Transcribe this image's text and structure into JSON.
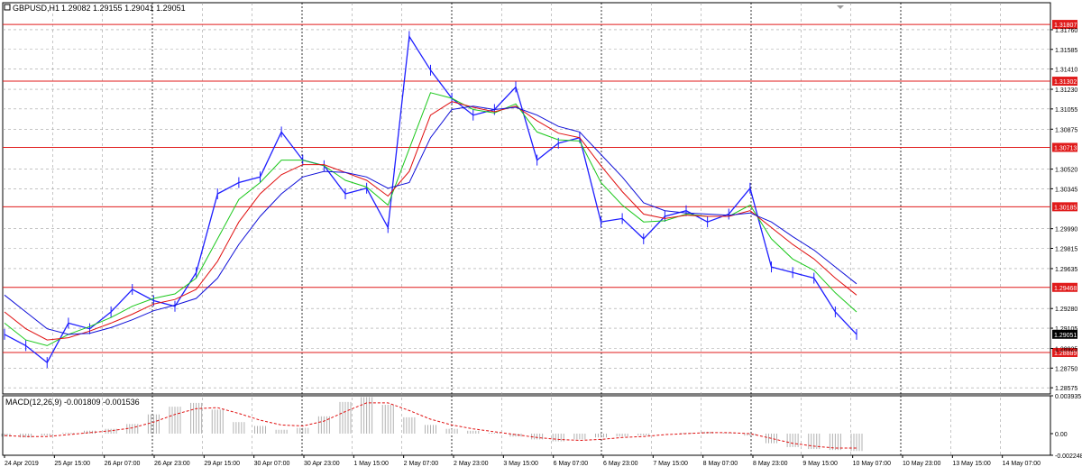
{
  "window": {
    "title": "GBPUSD,H1",
    "ohlc": "1.29082 1.29155 1.29041 1.29051"
  },
  "indicator": {
    "label": "MACD(12,26,9) -0.001809 -0.001536"
  },
  "price_axis": {
    "ticks": [
      "1.31760",
      "1.31585",
      "1.31410",
      "1.31230",
      "1.31055",
      "1.30875",
      "1.30520",
      "1.30345",
      "1.29990",
      "1.29815",
      "1.29635",
      "1.29280",
      "1.29105",
      "1.28925",
      "1.28750",
      "1.28575"
    ],
    "current_price": "1.29051"
  },
  "hlines": [
    {
      "label": "1.31807",
      "price": 1.31807
    },
    {
      "label": "1.31302",
      "price": 1.31302
    },
    {
      "label": "1.30713",
      "price": 1.30713
    },
    {
      "label": "1.30185",
      "price": 1.30185
    },
    {
      "label": "1.29468",
      "price": 1.29468
    },
    {
      "label": "1.28889",
      "price": 1.28889
    }
  ],
  "macd_axis": {
    "ticks": [
      "0.003935",
      "0.00",
      "-0.002248"
    ]
  },
  "time_axis": {
    "labels": [
      "24 Apr 2019",
      "25 Apr 15:00",
      "26 Apr 07:00",
      "26 Apr 23:00",
      "29 Apr 15:00",
      "30 Apr 07:00",
      "30 Apr 23:00",
      "1 May 15:00",
      "2 May 07:00",
      "2 May 23:00",
      "3 May 15:00",
      "6 May 07:00",
      "6 May 23:00",
      "7 May 15:00",
      "8 May 07:00",
      "8 May 23:00",
      "9 May 15:00",
      "10 May 07:00",
      "10 May 23:00",
      "13 May 15:00",
      "14 May 07:00"
    ]
  },
  "chart_data": {
    "type": "line",
    "title": "GBPUSD,H1",
    "series": [
      {
        "name": "GBPUSD,H1",
        "values": [
          1.2905,
          1.2895,
          1.288,
          1.2915,
          1.291,
          1.2925,
          1.2945,
          1.2935,
          1.293,
          1.296,
          1.303,
          1.304,
          1.3045,
          1.3085,
          1.306,
          1.3055,
          1.303,
          1.3035,
          1.3,
          1.317,
          1.314,
          1.3115,
          1.31,
          1.3105,
          1.3125,
          1.306,
          1.3075,
          1.308,
          1.3005,
          1.3008,
          1.299,
          1.301,
          1.3015,
          1.3005,
          1.3012,
          1.3035,
          1.2965,
          1.296,
          1.2955,
          1.2925,
          1.2905
        ]
      },
      {
        "name": "",
        "values": [
          1.2915,
          1.29,
          1.2895,
          1.2905,
          1.2912,
          1.292,
          1.293,
          1.2937,
          1.2941,
          1.2955,
          1.299,
          1.3025,
          1.304,
          1.306,
          1.306,
          1.3055,
          1.3042,
          1.3036,
          1.302,
          1.307,
          1.312,
          1.3115,
          1.3105,
          1.3102,
          1.311,
          1.3085,
          1.3078,
          1.3077,
          1.304,
          1.302,
          1.3005,
          1.3006,
          1.3012,
          1.301,
          1.301,
          1.302,
          1.299,
          1.2972,
          1.2962,
          1.2942,
          1.2925
        ]
      },
      {
        "name": "",
        "values": [
          1.2925,
          1.291,
          1.29,
          1.2902,
          1.2908,
          1.2915,
          1.2923,
          1.2932,
          1.2936,
          1.2945,
          1.297,
          1.3005,
          1.303,
          1.3047,
          1.3056,
          1.3056,
          1.3049,
          1.3042,
          1.3028,
          1.305,
          1.31,
          1.3112,
          1.3107,
          1.3103,
          1.3108,
          1.3095,
          1.3084,
          1.308,
          1.3055,
          1.3032,
          1.3012,
          1.3008,
          1.3011,
          1.301,
          1.301,
          1.3015,
          1.3,
          1.2985,
          1.2972,
          1.2955,
          1.294
        ]
      },
      {
        "name": "",
        "values": [
          1.294,
          1.2925,
          1.291,
          1.2905,
          1.2906,
          1.2911,
          1.2918,
          1.2926,
          1.2931,
          1.2937,
          1.2955,
          1.2985,
          1.301,
          1.303,
          1.3045,
          1.305,
          1.3049,
          1.3045,
          1.3035,
          1.304,
          1.308,
          1.3105,
          1.3108,
          1.3105,
          1.3107,
          1.31,
          1.309,
          1.3085,
          1.3065,
          1.3045,
          1.3022,
          1.3015,
          1.3013,
          1.3012,
          1.3011,
          1.3013,
          1.3005,
          1.2992,
          1.298,
          1.2965,
          1.295
        ]
      }
    ],
    "macd_values": [
      -0.0003,
      -0.0004,
      -0.0002,
      0.0001,
      0.0003,
      0.0005,
      0.001,
      0.002,
      0.0028,
      0.0032,
      0.0025,
      0.0012,
      0.0008,
      0.0004,
      0.0006,
      0.0018,
      0.0033,
      0.0038,
      0.003,
      0.0017,
      0.0009,
      0.0005,
      0.0003,
      0.0001,
      -0.0003,
      -0.0006,
      -0.0008,
      -0.0006,
      -0.0004,
      -0.0003,
      -0.0002,
      0.0,
      0.0001,
      0.0002,
      0.0001,
      -0.0002,
      -0.001,
      -0.0014,
      -0.0016,
      -0.0017,
      -0.0018
    ],
    "signal_values": [
      -0.0002,
      -0.0003,
      -0.0003,
      -0.0001,
      0.0001,
      0.0003,
      0.0006,
      0.0012,
      0.002,
      0.0026,
      0.0027,
      0.0021,
      0.0014,
      0.0009,
      0.0008,
      0.0013,
      0.0023,
      0.0032,
      0.0032,
      0.0024,
      0.0015,
      0.0009,
      0.0005,
      0.0002,
      -0.0001,
      -0.0004,
      -0.0006,
      -0.0007,
      -0.0006,
      -0.0004,
      -0.0003,
      -0.0001,
      0.0,
      0.0001,
      0.0001,
      0.0,
      -0.0005,
      -0.001,
      -0.0013,
      -0.0015,
      -0.0015
    ],
    "ylim": [
      1.2852,
      1.32
    ],
    "macd_ylim": [
      -0.00225,
      0.00394
    ],
    "colors": {
      "price": "#1e1eff",
      "ma_fast": "#1bc81b",
      "ma_mid": "#e01010",
      "ma_slow": "#1010d8",
      "hline": "#e01b1b",
      "grid": "#a0a0a0"
    }
  }
}
